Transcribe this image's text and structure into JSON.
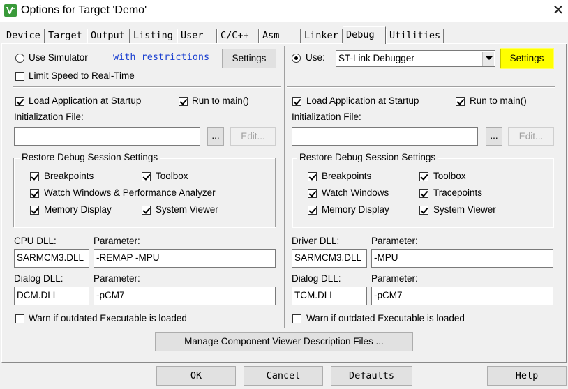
{
  "window": {
    "title": "Options for Target 'Demo'",
    "close_glyph": "✕"
  },
  "tabs": [
    {
      "label": "Device"
    },
    {
      "label": "Target"
    },
    {
      "label": "Output"
    },
    {
      "label": "Listing"
    },
    {
      "label": "User"
    },
    {
      "label": "C/C++"
    },
    {
      "label": "Asm"
    },
    {
      "label": "Linker"
    },
    {
      "label": "Debug",
      "active": true
    },
    {
      "label": "Utilities"
    }
  ],
  "left": {
    "use_simulator_label": "Use Simulator",
    "use_simulator_selected": false,
    "restrictions_link": "with restrictions",
    "settings_label": "Settings",
    "limit_speed_label": "Limit Speed to Real-Time",
    "limit_speed_checked": false,
    "load_app_label": "Load Application at Startup",
    "load_app_checked": true,
    "run_to_main_label": "Run to main()",
    "run_to_main_checked": true,
    "init_file_label": "Initialization File:",
    "init_file_value": "",
    "browse_label": "...",
    "edit_label": "Edit...",
    "restore_title": "Restore Debug Session Settings",
    "restore": {
      "breakpoints": "Breakpoints",
      "toolbox": "Toolbox",
      "watch": "Watch Windows & Performance Analyzer",
      "memory": "Memory Display",
      "system_viewer": "System Viewer"
    },
    "dll1_label": "CPU DLL:",
    "dll1_value": "SARMCM3.DLL",
    "param1_label": "Parameter:",
    "param1_value": "-REMAP -MPU",
    "dll2_label": "Dialog DLL:",
    "dll2_value": "DCM.DLL",
    "param2_label": "Parameter:",
    "param2_value": "-pCM7",
    "warn_label": "Warn if outdated Executable is loaded",
    "warn_checked": false
  },
  "right": {
    "use_label": "Use:",
    "use_selected": true,
    "debugger_value": "ST-Link Debugger",
    "settings_label": "Settings",
    "load_app_label": "Load Application at Startup",
    "load_app_checked": true,
    "run_to_main_label": "Run to main()",
    "run_to_main_checked": true,
    "init_file_label": "Initialization File:",
    "init_file_value": "",
    "browse_label": "...",
    "edit_label": "Edit...",
    "restore_title": "Restore Debug Session Settings",
    "restore": {
      "breakpoints": "Breakpoints",
      "toolbox": "Toolbox",
      "watch": "Watch Windows",
      "tracepoints": "Tracepoints",
      "memory": "Memory Display",
      "system_viewer": "System Viewer"
    },
    "dll1_label": "Driver DLL:",
    "dll1_value": "SARMCM3.DLL",
    "param1_label": "Parameter:",
    "param1_value": "-MPU",
    "dll2_label": "Dialog DLL:",
    "dll2_value": "TCM.DLL",
    "param2_label": "Parameter:",
    "param2_value": "-pCM7",
    "warn_label": "Warn if outdated Executable is loaded",
    "warn_checked": false
  },
  "manage_button": "Manage Component Viewer Description Files ...",
  "footer": {
    "ok": "OK",
    "cancel": "Cancel",
    "defaults": "Defaults",
    "help": "Help"
  },
  "colors": {
    "highlight": "#ffff00",
    "link": "#1a3fd0",
    "dialog_bg": "#f0f0f0"
  }
}
